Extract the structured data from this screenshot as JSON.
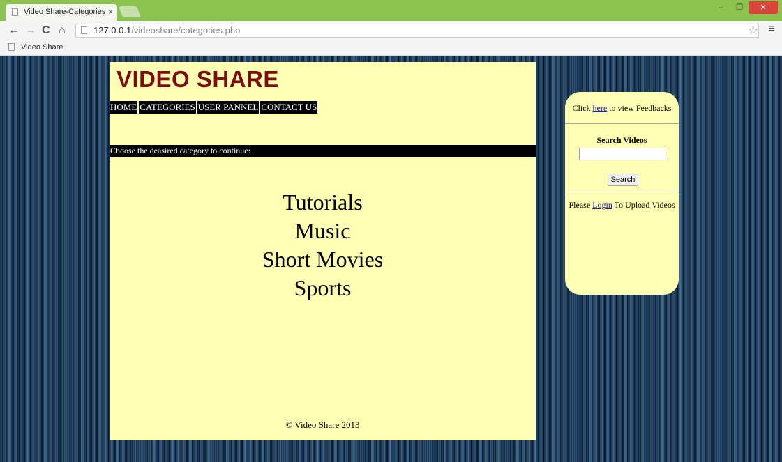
{
  "browser": {
    "tab_title": "Video Share-Categories",
    "tab_close": "×",
    "url_host": "127.0.0.1",
    "url_path": "/videoshare/categories.php",
    "bookmark": "Video Share",
    "title_bar_color": "#8cc24e"
  },
  "site": {
    "title": "VIDEO SHARE",
    "title_color": "#7d0b12",
    "panel_color": "#ffffb4",
    "nav": [
      "HOME",
      "CATEGORIES",
      "USER PANNEL",
      "CONTACT US"
    ],
    "instruction": "Choose the deasired category to continue:",
    "categories": [
      "Tutorials",
      "Music",
      "Short Movies",
      "Sports"
    ],
    "footer": "© Video Share 2013"
  },
  "sidebar": {
    "feedback_pre": "Click ",
    "feedback_link": "here",
    "feedback_post": " to view Feedbacks",
    "search_heading": "Search Videos",
    "search_value": "",
    "search_button": "Search",
    "upload_pre": "Please ",
    "upload_link": "Login",
    "upload_post": " To Upload Videos"
  }
}
